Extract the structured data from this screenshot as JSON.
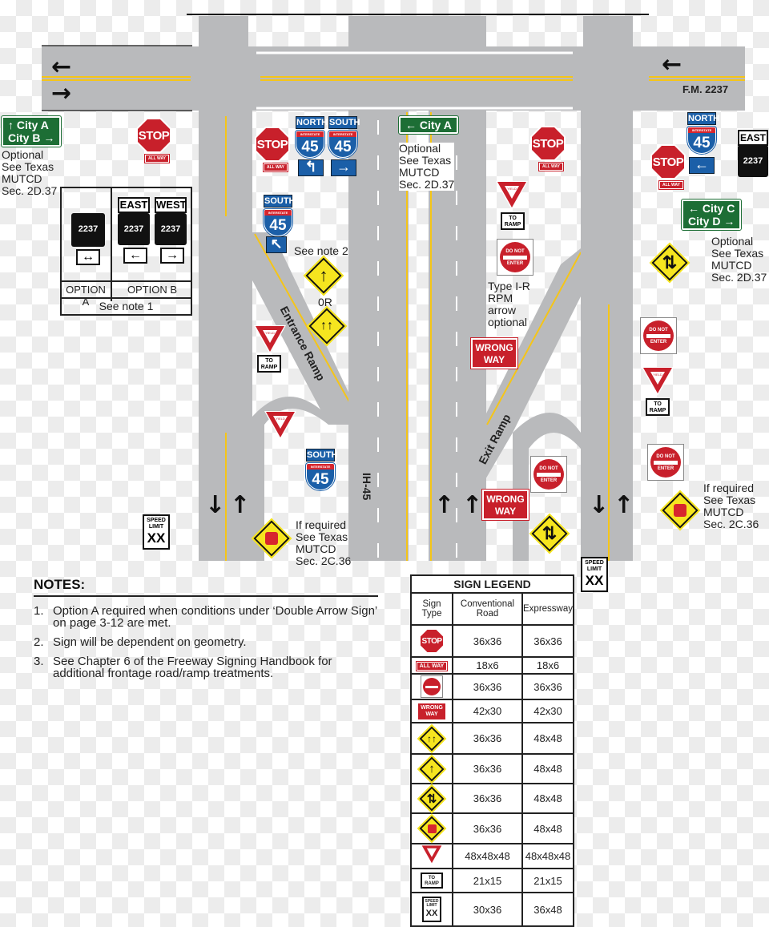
{
  "road": {
    "crossroad": "F.M. 2237",
    "freeway": "IH-45",
    "entrance_ramp": "Entrance Ramp",
    "exit_ramp": "Exit Ramp"
  },
  "guide_signs": {
    "left": {
      "line1": "↑ City A",
      "line2": "City B →"
    },
    "center": {
      "line1": "← City A"
    },
    "right": {
      "line1": "← City C",
      "line2": "City D →"
    }
  },
  "annotations": {
    "optional_left": "Optional\nSee Texas\nMUTCD\nSec. 2D.37",
    "optional_center": "Optional\nSee Texas\nMUTCD\nSec. 2D.37",
    "optional_right": "Optional\nSee Texas\nMUTCD\nSec. 2D.37",
    "see_note_2": "See note 2",
    "or": "0R",
    "rpm": "Type I-R\nRPM\narrow\noptional",
    "if_required_left": "If required\nSee Texas\nMUTCD\nSec. 2C.36",
    "if_required_right": "If required\nSee Texas\nMUTCD\nSec. 2C.36"
  },
  "signs": {
    "stop": "STOP",
    "all_way": "ALL WAY",
    "north": "NORTH",
    "south": "SOUTH",
    "east": "EAST",
    "west": "WEST",
    "interstate": "INTERSTATE",
    "route": "45",
    "yield": "YIELD",
    "to": "TO",
    "ramp": "RAMP",
    "do_not": "DO NOT",
    "enter": "ENTER",
    "wrong": "WRONG",
    "way": "WAY",
    "speed": "SPEED",
    "limit": "LIMIT",
    "xx": "XX",
    "farm": "FARM",
    "road_word": "ROAD",
    "fm_number": "2237"
  },
  "options": {
    "a": "OPTION A",
    "b": "OPTION B",
    "note": "See note 1"
  },
  "notes": {
    "title": "NOTES:",
    "items": [
      {
        "num": "1.",
        "text": " Option A required when conditions under ‘Double Arrow Sign’ on page 3-12 are met."
      },
      {
        "num": "2.",
        "text": "Sign will be dependent on geometry."
      },
      {
        "num": "3.",
        "text": "See Chapter 6 of the Freeway Signing Handbook for additional frontage road/ramp treatments."
      }
    ]
  },
  "legend": {
    "title": "SIGN LEGEND",
    "headers": [
      "Sign Type",
      "Conventional Road",
      "Expressway"
    ],
    "rows": [
      {
        "sign": "stop-sign",
        "conventional": "36x36",
        "expressway": "36x36"
      },
      {
        "sign": "all-way-plate",
        "conventional": "18x6",
        "expressway": "18x6"
      },
      {
        "sign": "do-not-enter-sign",
        "conventional": "36x36",
        "expressway": "36x36"
      },
      {
        "sign": "wrong-way-sign",
        "conventional": "42x30",
        "expressway": "42x30"
      },
      {
        "sign": "lane-ends-merge-sign",
        "conventional": "36x36",
        "expressway": "48x48"
      },
      {
        "sign": "merge-sign",
        "conventional": "36x36",
        "expressway": "48x48"
      },
      {
        "sign": "two-way-traffic-sign",
        "conventional": "36x36",
        "expressway": "48x48"
      },
      {
        "sign": "stop-ahead-sign",
        "conventional": "36x36",
        "expressway": "48x48"
      },
      {
        "sign": "yield-sign",
        "conventional": "48x48x48",
        "expressway": "48x48x48"
      },
      {
        "sign": "to-ramp-plate",
        "conventional": "21x15",
        "expressway": "21x15"
      },
      {
        "sign": "speed-limit-sign",
        "conventional": "30x36",
        "expressway": "36x48"
      }
    ]
  },
  "colors": {
    "road": "#b9babc",
    "centerline": "#f5c518",
    "guide": "#1d6e35",
    "regulatory": "#c8202b",
    "warning": "#f6e51f",
    "interstate": "#1b5fa8"
  }
}
